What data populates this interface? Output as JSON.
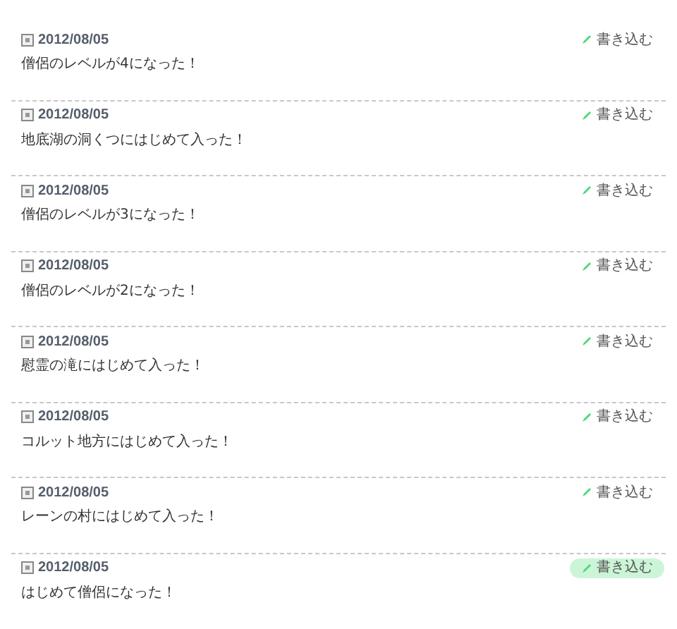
{
  "entries": [
    {
      "date": "2012/08/05",
      "text": "僧侶のレベルが4になった！",
      "button": "書き込む",
      "highlighted": false
    },
    {
      "date": "2012/08/05",
      "text": "地底湖の洞くつにはじめて入った！",
      "button": "書き込む",
      "highlighted": false
    },
    {
      "date": "2012/08/05",
      "text": "僧侶のレベルが3になった！",
      "button": "書き込む",
      "highlighted": false
    },
    {
      "date": "2012/08/05",
      "text": "僧侶のレベルが2になった！",
      "button": "書き込む",
      "highlighted": false
    },
    {
      "date": "2012/08/05",
      "text": "慰霊の滝にはじめて入った！",
      "button": "書き込む",
      "highlighted": false
    },
    {
      "date": "2012/08/05",
      "text": "コルット地方にはじめて入った！",
      "button": "書き込む",
      "highlighted": false
    },
    {
      "date": "2012/08/05",
      "text": "レーンの村にはじめて入った！",
      "button": "書き込む",
      "highlighted": false
    },
    {
      "date": "2012/08/05",
      "text": "はじめて僧侶になった！",
      "button": "書き込む",
      "highlighted": true
    }
  ]
}
